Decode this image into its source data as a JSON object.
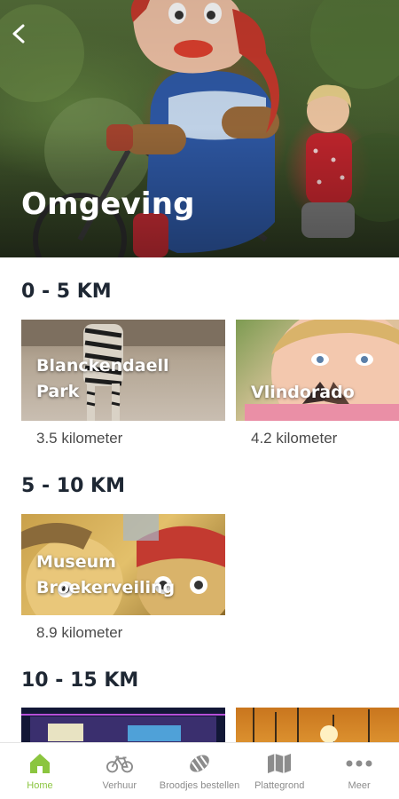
{
  "header": {
    "title": "Omgeving",
    "back_icon": "back-arrow-icon"
  },
  "sections": [
    {
      "title": "0 - 5 KM",
      "items": [
        {
          "name": "Blanckendaell Park",
          "distance": "3.5 kilometer",
          "image": "zebra-photo"
        },
        {
          "name": "Vlindorado",
          "distance": "4.2 kilometer",
          "image": "child-butterfly-photo"
        }
      ]
    },
    {
      "title": "5 - 10 KM",
      "items": [
        {
          "name": "Museum Broekerveiling",
          "distance": "8.9 kilometer",
          "image": "mascot-photo"
        }
      ]
    },
    {
      "title": "10 - 15 KM",
      "items": [
        {
          "image": "night-building-photo"
        },
        {
          "image": "sunset-photo"
        }
      ]
    }
  ],
  "nav": {
    "active_color": "#8bc53f",
    "inactive_color": "#8c8c8c",
    "items": [
      {
        "label": "Home",
        "icon": "home-icon",
        "active": true
      },
      {
        "label": "Verhuur",
        "icon": "bicycle-icon",
        "active": false
      },
      {
        "label": "Broodjes bestellen",
        "icon": "bread-icon",
        "active": false
      },
      {
        "label": "Plattegrond",
        "icon": "map-icon",
        "active": false
      },
      {
        "label": "Meer",
        "icon": "more-icon",
        "active": false
      }
    ]
  }
}
